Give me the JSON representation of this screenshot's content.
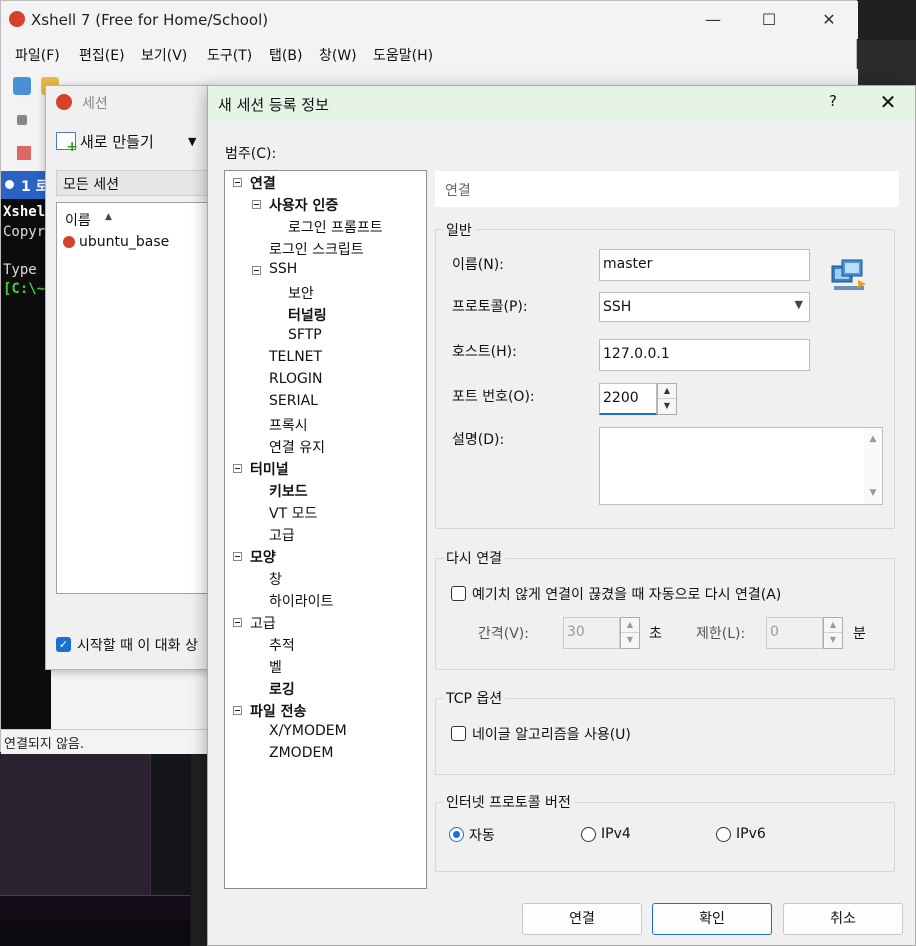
{
  "xshell": {
    "title": "Xshell 7 (Free for Home/School)",
    "menu": [
      "파일(F)",
      "편집(E)",
      "보기(V)",
      "도구(T)",
      "탭(B)",
      "창(W)",
      "도움말(H)"
    ],
    "tab_label": "1 로",
    "terminal_lines": [
      "Xshel",
      "Copyr",
      "",
      "Type",
      "[C:\\~"
    ],
    "status": "연결되지 않음."
  },
  "sessions_dialog": {
    "title": "세션",
    "new_button": "새로 만들기",
    "folder": "모든 세션",
    "column_name": "이름",
    "items": [
      "ubuntu_base"
    ],
    "startup_checkbox": "시작할 때 이 대화 상"
  },
  "props_dialog": {
    "title": "새 세션 등록 정보",
    "help": "?",
    "close": "✕",
    "category_label": "범주(C):",
    "tree": {
      "connection": "연결",
      "user_auth": "사용자 인증",
      "login_prompt": "로그인 프롬프트",
      "login_script": "로그인 스크립트",
      "ssh": "SSH",
      "security": "보안",
      "tunneling": "터널링",
      "sftp": "SFTP",
      "telnet": "TELNET",
      "rlogin": "RLOGIN",
      "serial": "SERIAL",
      "proxy": "프록시",
      "keepalive": "연결 유지",
      "terminal": "터미널",
      "keyboard": "키보드",
      "vt_mode": "VT 모드",
      "advanced_term": "고급",
      "appearance": "모양",
      "window": "창",
      "highlight": "하이라이트",
      "advanced": "고급",
      "trace": "추적",
      "bell": "벨",
      "logging": "로깅",
      "file_transfer": "파일 전송",
      "xymodem": "X/YMODEM",
      "zmodem": "ZMODEM"
    },
    "pane_title": "연결",
    "general": {
      "title": "일반",
      "name_label": "이름(N):",
      "name_value": "master",
      "protocol_label": "프로토콜(P):",
      "protocol_value": "SSH",
      "host_label": "호스트(H):",
      "host_value": "127.0.0.1",
      "port_label": "포트 번호(O):",
      "port_value": "2200",
      "desc_label": "설명(D):"
    },
    "reconnect": {
      "title": "다시 연결",
      "checkbox": "예기치 않게 연결이 끊겼을 때 자동으로 다시 연결(A)",
      "interval_label": "간격(V):",
      "interval_value": "30",
      "interval_unit": "초",
      "limit_label": "제한(L):",
      "limit_value": "0",
      "limit_unit": "분"
    },
    "tcp": {
      "title": "TCP 옵션",
      "checkbox": "네이글 알고리즘을 사용(U)"
    },
    "ip_version": {
      "title": "인터넷 프로토콜 버전",
      "options": [
        "자동",
        "IPv4",
        "IPv6"
      ],
      "selected": "자동"
    },
    "buttons": {
      "connect": "연결",
      "ok": "확인",
      "cancel": "취소"
    }
  },
  "colors": {
    "accent": "#1a6fd0",
    "title_green": "#e6f4e6",
    "xshell_red": "#d6412a"
  }
}
